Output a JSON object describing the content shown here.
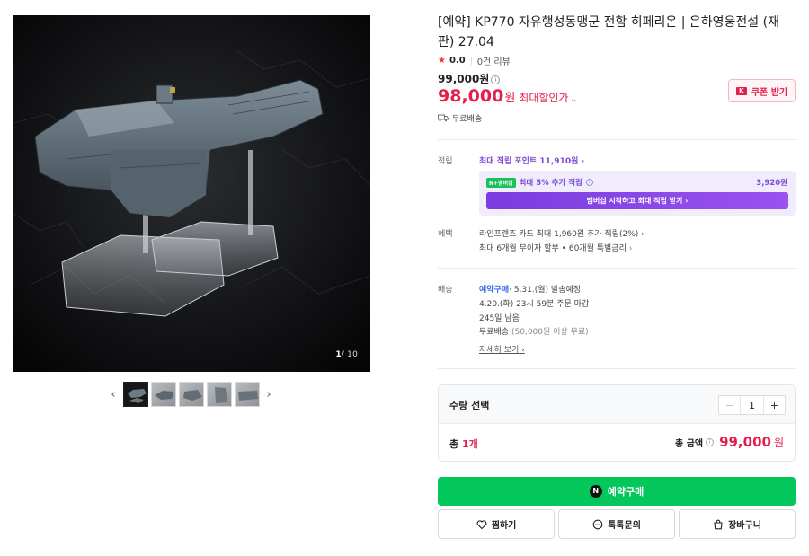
{
  "gallery": {
    "counter_current": "1",
    "counter_total": "/ 10",
    "prev_arrow": "‹",
    "next_arrow": "›",
    "thumbnail_count": 5
  },
  "product": {
    "title": "[예약] KP770 자유행성동맹군 전함 히페리온 | 은하영웅전설 (재판) 27.04",
    "rating": {
      "star": "★",
      "score": "0.0",
      "reviews": "0건 리뷰"
    },
    "original_price": "99,000원",
    "sale_price": {
      "number": "98,000",
      "unit": "원",
      "label": "최대할인가"
    },
    "coupon_label": "쿠폰 받기",
    "free_shipping": "무료배송"
  },
  "points": {
    "label": "적립",
    "max_link": "최대 적립 포인트 11,910원",
    "membership_badge": "N+멤버십",
    "membership_text": "최대 5% 추가 적립",
    "membership_amount": "3,920원",
    "membership_button": "멤버십 시작하고 최대 적립 받기"
  },
  "benefits": {
    "label": "혜택",
    "line1": "라인프렌즈 카드 최대 1,960원 추가 적립(2%)",
    "line2": "최대 6개월 무이자 할부 • 60개월 특별금리"
  },
  "delivery": {
    "label": "배송",
    "preorder": "예약구매",
    "ship_date": "· 5.31.(월) 발송예정",
    "deadline": "4.20.(화) 23시 59분 주문 마감",
    "remaining": "245일 남음",
    "free_text": "무료배송",
    "free_condition": "(50,000원 이상 무료)",
    "detail_link": "자세히 보기"
  },
  "quantity": {
    "label": "수량 선택",
    "minus": "−",
    "value": "1",
    "plus": "+",
    "total_label_prefix": "총",
    "total_count": "1개",
    "amount_label": "총 금액",
    "amount": "99,000",
    "amount_unit": "원"
  },
  "actions": {
    "buy_icon": "N",
    "buy": "예약구매",
    "wish": "찜하기",
    "talk": "톡톡문의",
    "cart": "장바구니"
  },
  "colors": {
    "sale_red": "#e41e4d",
    "naver_green": "#03c75a",
    "membership_purple": "#7d4bd6",
    "link_blue": "#3a6ee8"
  }
}
